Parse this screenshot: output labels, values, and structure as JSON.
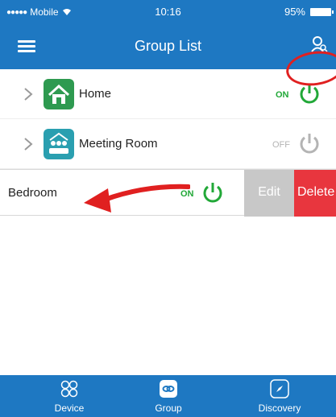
{
  "status_bar": {
    "carrier": "Mobile",
    "time": "10:16",
    "battery": "95%"
  },
  "nav": {
    "title": "Group List"
  },
  "groups": [
    {
      "label": "Home",
      "state": "ON",
      "icon": "house-icon"
    },
    {
      "label": "Meeting Room",
      "state": "OFF",
      "icon": "people-icon"
    }
  ],
  "swiped_row": {
    "label": "Bedroom",
    "state": "ON",
    "edit_label": "Edit",
    "delete_label": "Delete"
  },
  "tabs": [
    {
      "label": "Device",
      "icon": "grid-circles-icon"
    },
    {
      "label": "Group",
      "icon": "group-link-icon"
    },
    {
      "label": "Discovery",
      "icon": "compass-icon"
    }
  ],
  "colors": {
    "brand": "#1e78c2",
    "on": "#22a838",
    "off": "#b4b4b4",
    "delete": "#e8363e",
    "edit": "#c8c8c8",
    "annotation": "#e02020"
  }
}
